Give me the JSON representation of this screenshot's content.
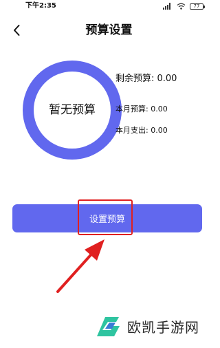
{
  "status_bar": {
    "time": "下午2:35",
    "battery": "77"
  },
  "nav": {
    "title": "预算设置"
  },
  "ring": {
    "label": "暂无预算",
    "color": "#6168ee"
  },
  "stats": {
    "remaining": "剩余预算: 0.00",
    "month_budget": "本月预算: 0.00",
    "month_spend": "本月支出: 0.00"
  },
  "actions": {
    "set_budget_label": "设置预算"
  },
  "annotation": {
    "color": "#e02020"
  },
  "watermark": {
    "text": "欧凯手游网",
    "logo_colors": [
      "#2fc4a0",
      "#3a7bd5"
    ]
  }
}
